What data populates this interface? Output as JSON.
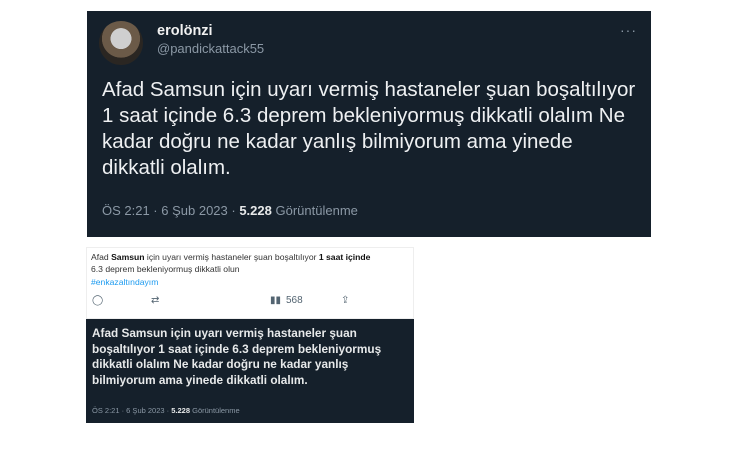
{
  "tweet": {
    "display_name": "erolönzi",
    "handle": "@pandickattack55",
    "more_icon": "ellipsis-icon",
    "text": "Afad Samsun için uyarı vermiş hastaneler şuan boşaltılıyor 1 saat içinde 6.3 deprem bekleniyormuş dikkatli olalım Ne kadar doğru ne kadar yanlış bilmiyorum ama yinede dikkatli olalım.",
    "time": "ÖS 2:21 · 6 Şub 2023 ·",
    "views": "5.228",
    "views_label": "Görüntülenme"
  },
  "composite": {
    "light_text_a": "Afad ",
    "light_text_b": "Samsun",
    "light_text_c": " için uyarı vermiş hastaneler şuan boşaltılıyor ",
    "light_text_d": "1 saat içinde",
    "light_text_e": "6.3 deprem bekleniyormuş dikkatli olun",
    "hashtag": "#enkazaltındayım",
    "reply_icon": "reply-icon",
    "retweet_icon": "retweet-icon",
    "like_icon": "like-icon",
    "stats_icon": "stats-icon",
    "stats_count": "568",
    "share_icon": "share-icon",
    "dark_text": "Afad Samsun için uyarı vermiş hastaneler şuan boşaltılıyor 1 saat içinde 6.3 deprem bekleniyormuş dikkatli olalım Ne kadar doğru ne kadar yanlış bilmiyorum ama yinede dikkatli olalım.",
    "dark_time": "ÖS 2:21 · 6 Şub 2023 ·",
    "dark_views": "5.228",
    "dark_views_label": "Görüntülenme"
  }
}
